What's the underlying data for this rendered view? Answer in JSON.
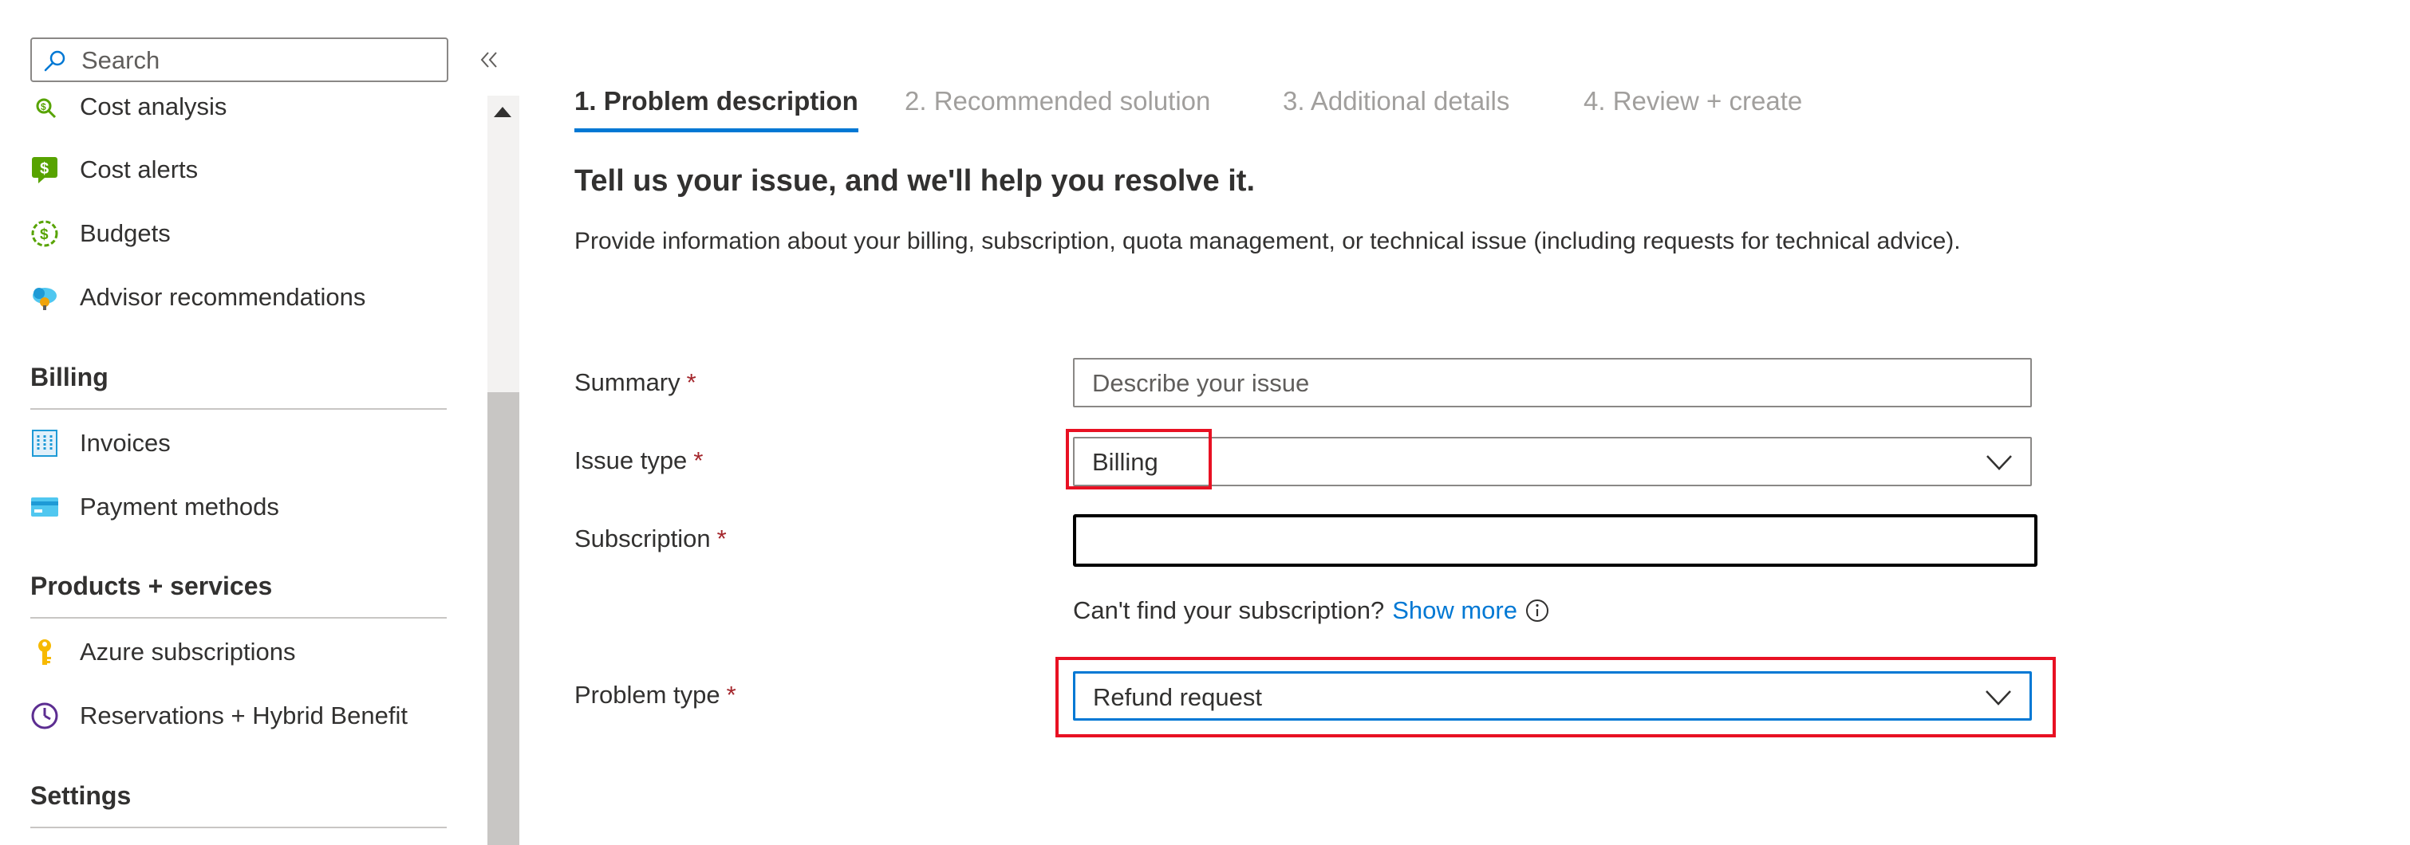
{
  "sidebar": {
    "search_placeholder": "Search",
    "items": [
      {
        "label": "Cost analysis",
        "icon": "cost-analysis-icon"
      },
      {
        "label": "Cost alerts",
        "icon": "cost-alerts-icon"
      },
      {
        "label": "Budgets",
        "icon": "budgets-icon"
      },
      {
        "label": "Advisor recommendations",
        "icon": "advisor-icon"
      },
      {
        "label": "Invoices",
        "icon": "invoices-icon"
      },
      {
        "label": "Payment methods",
        "icon": "payment-methods-icon"
      },
      {
        "label": "Azure subscriptions",
        "icon": "key-icon"
      },
      {
        "label": "Reservations + Hybrid Benefit",
        "icon": "reservations-clock-icon"
      }
    ],
    "sections": {
      "billing": "Billing",
      "products": "Products + services",
      "settings": "Settings"
    }
  },
  "wizard": {
    "tabs": [
      {
        "label": "1. Problem description",
        "active": true
      },
      {
        "label": "2. Recommended solution",
        "active": false
      },
      {
        "label": "3. Additional details",
        "active": false
      },
      {
        "label": "4. Review + create",
        "active": false
      }
    ],
    "heading": "Tell us your issue, and we'll help you resolve it.",
    "description": "Provide information about your billing, subscription, quota management, or technical issue (including requests for technical advice)."
  },
  "form": {
    "summary": {
      "label": "Summary",
      "required": "*",
      "placeholder": "Describe your issue",
      "value": ""
    },
    "issue_type": {
      "label": "Issue type",
      "required": "*",
      "value": "Billing"
    },
    "subscription": {
      "label": "Subscription",
      "required": "*",
      "value": ""
    },
    "subscription_hint": {
      "text": "Can't find your subscription?",
      "link": "Show more"
    },
    "problem_type": {
      "label": "Problem type",
      "required": "*",
      "value": "Refund request"
    }
  },
  "colors": {
    "accent": "#0078d4",
    "highlight": "#e81123",
    "required": "#a4262c",
    "inactive_tab": "#a19f9d"
  }
}
